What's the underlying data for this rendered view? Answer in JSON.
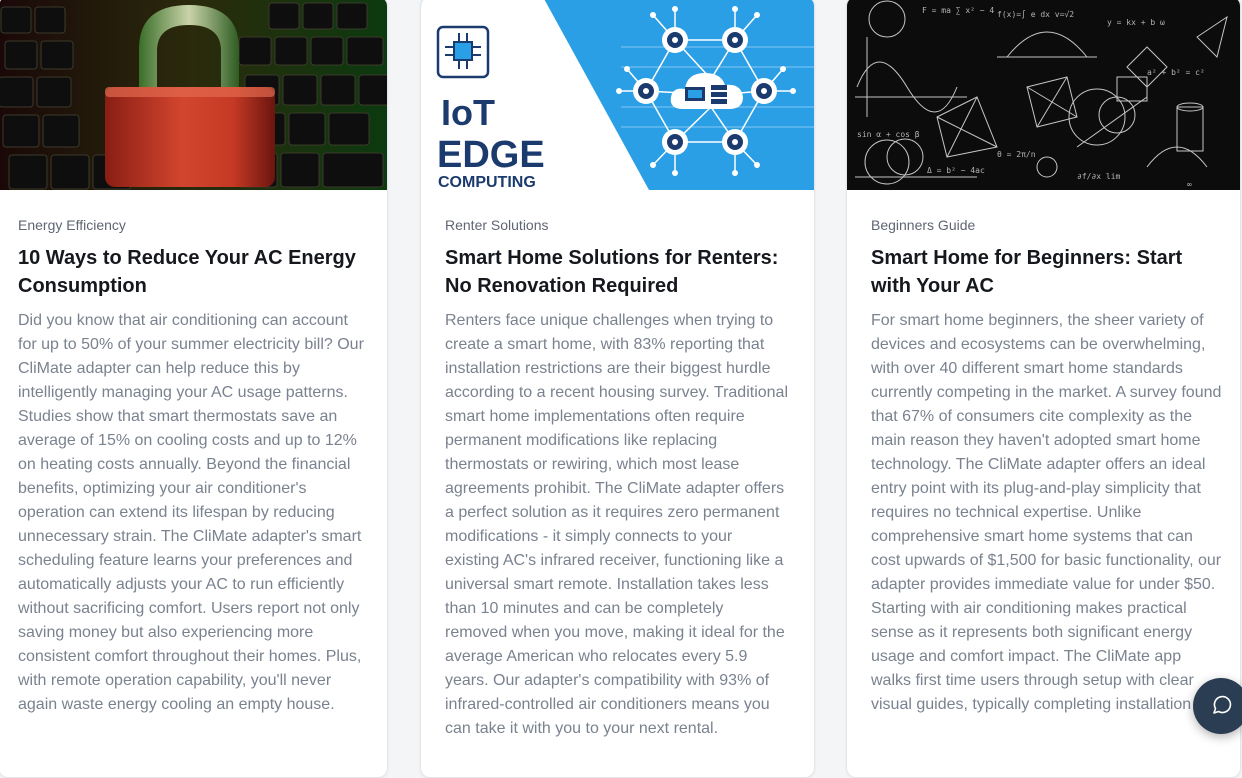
{
  "articles": [
    {
      "category": "Energy Efficiency",
      "title": "10 Ways to Reduce Your AC Energy Consumption",
      "excerpt": "Did you know that air conditioning can account for up to 50% of your summer electricity bill? Our CliMate adapter can help reduce this by intelligently managing your AC usage patterns. Studies show that smart thermostats save an average of 15% on cooling costs and up to 12% on heating costs annually. Beyond the financial benefits, optimizing your air conditioner's operation can extend its lifespan by reducing unnecessary strain. The CliMate adapter's smart scheduling feature learns your preferences and automatically adjusts your AC to run efficiently without sacrificing comfort. Users report not only saving money but also experiencing more consistent comfort throughout their homes. Plus, with remote operation capability, you'll never again waste energy cooling an empty house.",
      "image_icon": "padlock-on-keyboard-image"
    },
    {
      "category": "Renter Solutions",
      "title": "Smart Home Solutions for Renters: No Renovation Required",
      "excerpt": "Renters face unique challenges when trying to create a smart home, with 83% reporting that installation restrictions are their biggest hurdle according to a recent housing survey. Traditional smart home implementations often require permanent modifications like replacing thermostats or rewiring, which most lease agreements prohibit. The CliMate adapter offers a perfect solution as it requires zero permanent modifications - it simply connects to your existing AC's infrared receiver, functioning like a universal smart remote. Installation takes less than 10 minutes and can be completely removed when you move, making it ideal for the average American who relocates every 5.9 years. Our adapter's compatibility with 93% of infrared-controlled air conditioners means you can take it with you to your next rental.",
      "image_text": {
        "line1": "IoT",
        "line2": "EDGE",
        "line3": "COMPUTING"
      }
    },
    {
      "category": "Beginners Guide",
      "title": "Smart Home for Beginners: Start with Your AC",
      "excerpt": "For smart home beginners, the sheer variety of devices and ecosystems can be overwhelming, with over 40 different smart home standards currently competing in the market. A survey found that 67% of consumers cite complexity as the main reason they haven't adopted smart home technology. The CliMate adapter offers an ideal entry point with its plug-and-play simplicity that requires no technical expertise. Unlike comprehensive smart home systems that can cost upwards of $1,500 for basic functionality, our adapter provides immediate value for under $50. Starting with air conditioning makes practical sense as it represents both significant energy usage and comfort impact. The CliMate app walks first time users through setup with clear visual guides, typically completing installation in",
      "image_icon": "math-chalkboard-image"
    }
  ],
  "colors": {
    "brand_blue": "#2b9fe6",
    "navy": "#1b3a6e",
    "chat_button": "#2b3d52"
  },
  "chat_button_icon": "chat-bubble-icon"
}
